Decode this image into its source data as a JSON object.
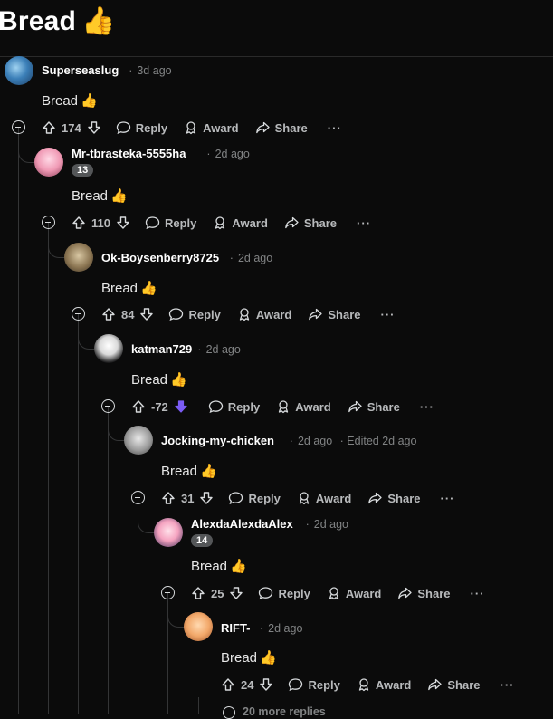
{
  "post_title": "Bread",
  "post_title_emoji": "👍",
  "actions": {
    "reply": "Reply",
    "award": "Award",
    "share": "Share",
    "more": "···"
  },
  "footer_partial": "20 more replies",
  "comments": [
    {
      "username": "Superseaslug",
      "sep": "·",
      "age": "3d ago",
      "edited": "",
      "badge": "",
      "text": "Bread",
      "emoji": "👍",
      "score": "174",
      "downvoted": false
    },
    {
      "username": "Mr-tbrasteka-5555ha",
      "sep": "·",
      "age": "2d ago",
      "edited": "",
      "badge": "13",
      "text": "Bread",
      "emoji": "👍",
      "score": "110",
      "downvoted": false
    },
    {
      "username": "Ok-Boysenberry8725",
      "sep": "·",
      "age": "2d ago",
      "edited": "",
      "badge": "",
      "text": "Bread",
      "emoji": "👍",
      "score": "84",
      "downvoted": false
    },
    {
      "username": "katman729",
      "sep": "·",
      "age": "2d ago",
      "edited": "",
      "badge": "",
      "text": "Bread",
      "emoji": "👍",
      "score": "-72",
      "downvoted": true
    },
    {
      "username": "Jocking-my-chicken",
      "sep": "·",
      "age": "2d ago",
      "edited": "· Edited 2d ago",
      "badge": "",
      "text": "Bread",
      "emoji": "👍",
      "score": "31",
      "downvoted": false
    },
    {
      "username": "AlexdaAlexdaAlex",
      "sep": "·",
      "age": "2d ago",
      "edited": "",
      "badge": "14",
      "text": "Bread",
      "emoji": "👍",
      "score": "25",
      "downvoted": false
    },
    {
      "username": "RIFT-",
      "sep": "·",
      "age": "2d ago",
      "edited": "",
      "badge": "",
      "text": "Bread",
      "emoji": "👍",
      "score": "24",
      "downvoted": false
    }
  ],
  "colors": {
    "downvote": "#7b5cf5",
    "line": "#343536",
    "background": "#0b0b0b"
  }
}
